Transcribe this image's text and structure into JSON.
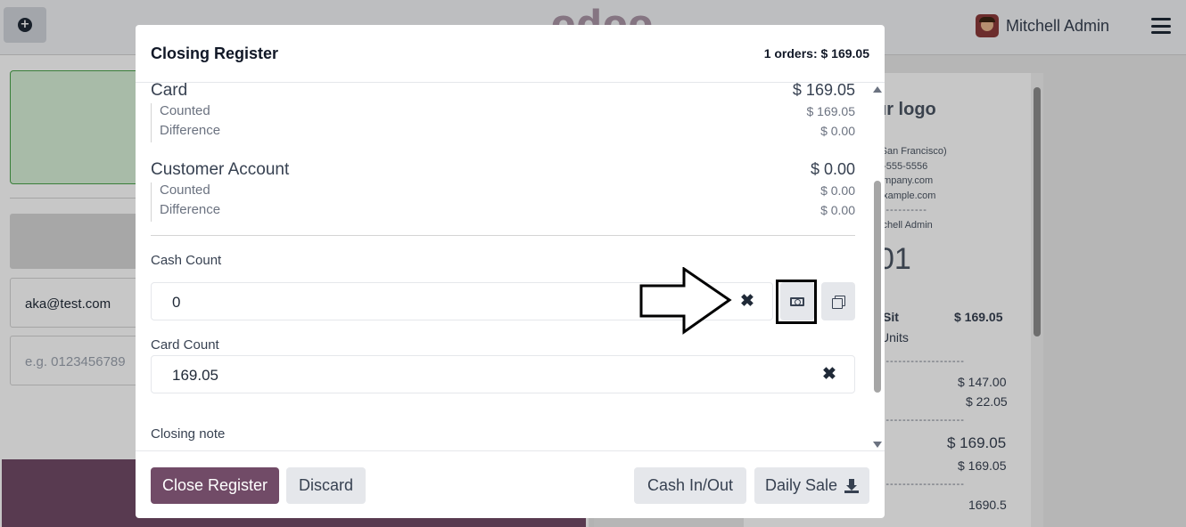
{
  "app": {
    "brand": "odoo",
    "user_name": "Mitchell Admin"
  },
  "background": {
    "customer_email": "aka@test.com",
    "phone_placeholder": "e.g. 0123456789",
    "receipt": {
      "logo_text": "ur logo",
      "lines": [
        "(San Francisco)",
        "5-555-5556",
        "ompany.com",
        "example.com"
      ],
      "served_by": "itchell Admin",
      "order_number": "01",
      "product": "Sit",
      "product_total": "$ 169.05",
      "units": "Units",
      "subtotal_1": "$ 147.00",
      "subtotal_2": "$ 22.05",
      "total": "$ 169.05",
      "paid": "$ 169.05",
      "footer_number": "1690.5"
    }
  },
  "modal": {
    "title": "Closing Register",
    "summary": "1 orders: $ 169.05",
    "payment_methods": [
      {
        "name": "Card",
        "total": "$ 169.05",
        "counted_label": "Counted",
        "counted": "$ 169.05",
        "difference_label": "Difference",
        "difference": "$ 0.00"
      },
      {
        "name": "Customer Account",
        "total": "$ 0.00",
        "counted_label": "Counted",
        "counted": "$ 0.00",
        "difference_label": "Difference",
        "difference": "$ 0.00"
      }
    ],
    "cash_count": {
      "label": "Cash Count",
      "value": "0"
    },
    "card_count": {
      "label": "Card Count",
      "value": "169.05"
    },
    "closing_note_label": "Closing note",
    "buttons": {
      "close_register": "Close Register",
      "discard": "Discard",
      "cash_in_out": "Cash In/Out",
      "daily_sale": "Daily Sale"
    }
  },
  "icons": {
    "add": "plus-circle-icon",
    "menu": "hamburger-icon",
    "clear": "times-icon",
    "money": "money-bill-icon",
    "copy": "copy-icon",
    "download": "download-icon",
    "annotation": "arrow-right-icon"
  },
  "colors": {
    "primary": "#714b67",
    "secondary_button": "#e5e7eb"
  }
}
